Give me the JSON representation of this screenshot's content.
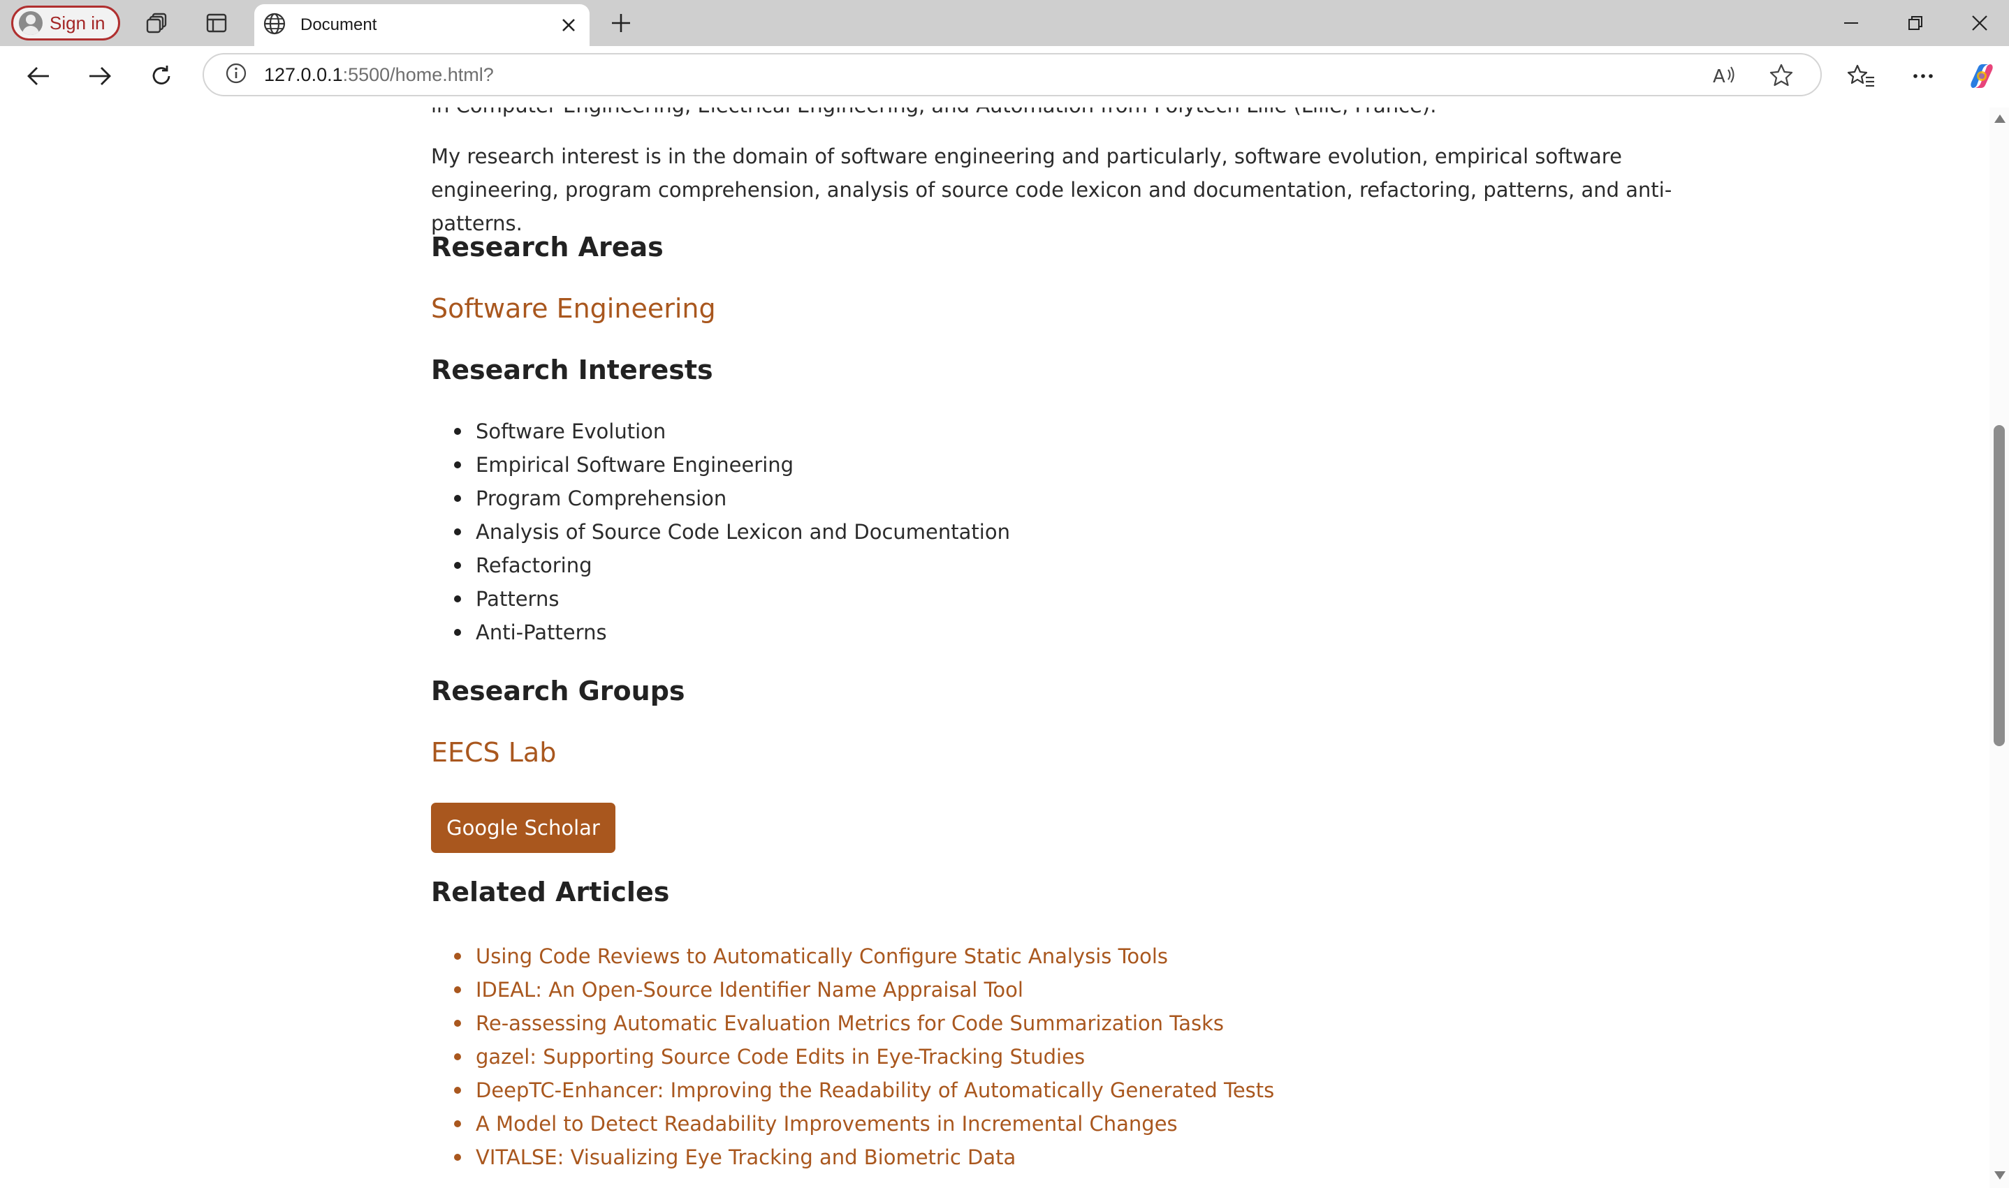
{
  "browser": {
    "signin_label": "Sign in",
    "tab_title": "Document",
    "url_host": "127.0.0.1",
    "url_rest": ":5500/home.html?"
  },
  "page": {
    "cut_line": "in Computer Engineering, Electrical Engineering, and Automation from Polytech Lille (Lille, France).",
    "intro": "My research interest is in the domain of software engineering and particularly, software evolution, empirical software engineering, program comprehension, analysis of source code lexicon and documentation, refactoring, patterns, and anti-patterns.",
    "research_areas_heading": "Research Areas",
    "research_area_link": "Software Engineering",
    "research_interests_heading": "Research Interests",
    "interests": [
      "Software Evolution",
      "Empirical Software Engineering",
      "Program Comprehension",
      "Analysis of Source Code Lexicon and Documentation",
      "Refactoring",
      "Patterns",
      "Anti-Patterns"
    ],
    "research_groups_heading": "Research Groups",
    "group_link": "EECS Lab",
    "scholar_button": "Google Scholar",
    "related_articles_heading": "Related Articles",
    "articles": [
      "Using Code Reviews to Automatically Configure Static Analysis Tools",
      "IDEAL: An Open-Source Identifier Name Appraisal Tool",
      "Re-assessing Automatic Evaluation Metrics for Code Summarization Tasks",
      "gazel: Supporting Source Code Edits in Eye-Tracking Studies",
      "DeepTC-Enhancer: Improving the Readability of Automatically Generated Tests",
      "A Model to Detect Readability Improvements in Incremental Changes",
      "VITALSE: Visualizing Eye Tracking and Biometric Data"
    ]
  },
  "colors": {
    "accent": "#a9571e",
    "signin_border": "#b02f2f",
    "tabbar_bg": "#cfcfcf"
  }
}
